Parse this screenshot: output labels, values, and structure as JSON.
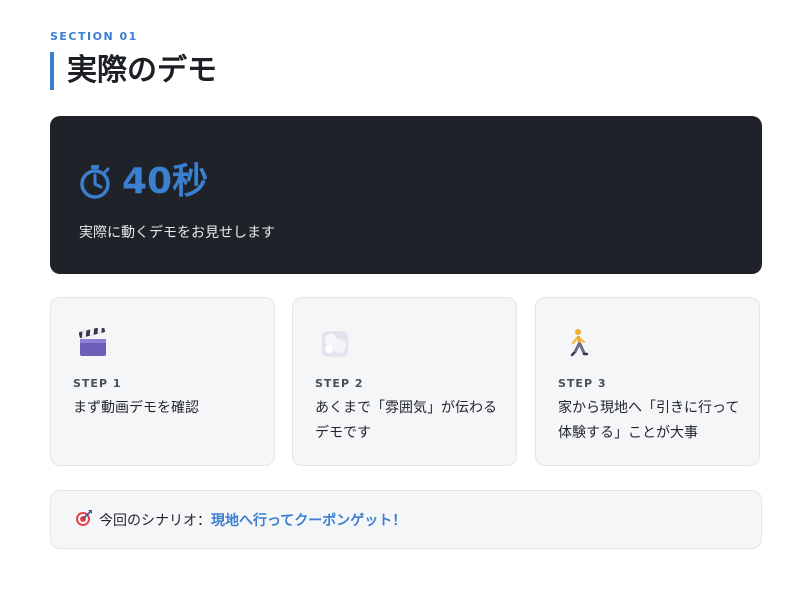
{
  "section": {
    "label": "SECTION 01"
  },
  "header": {
    "title": "実際のデモ"
  },
  "hero": {
    "icon": "stopwatch-icon",
    "value": "40秒",
    "caption": "実際に動くデモをお見せします"
  },
  "steps": [
    {
      "icon": "clapper-board-icon",
      "label": "STEP 1",
      "text": "まず動画デモを確認"
    },
    {
      "icon": "fog-icon",
      "label": "STEP 2",
      "text": "あくまで「雰囲気」が伝わるデモです"
    },
    {
      "icon": "walking-person-icon",
      "label": "STEP 3",
      "text": "家から現地へ「引きに行って体験する」ことが大事"
    }
  ],
  "scenario": {
    "icon": "target-icon",
    "prefix": "今回のシナリオ：",
    "highlight": "現地へ行ってクーポンゲット！"
  },
  "colors": {
    "accent": "#3b7fd1",
    "hero_background": "#1f2228",
    "card_background": "#f5f6f8"
  }
}
